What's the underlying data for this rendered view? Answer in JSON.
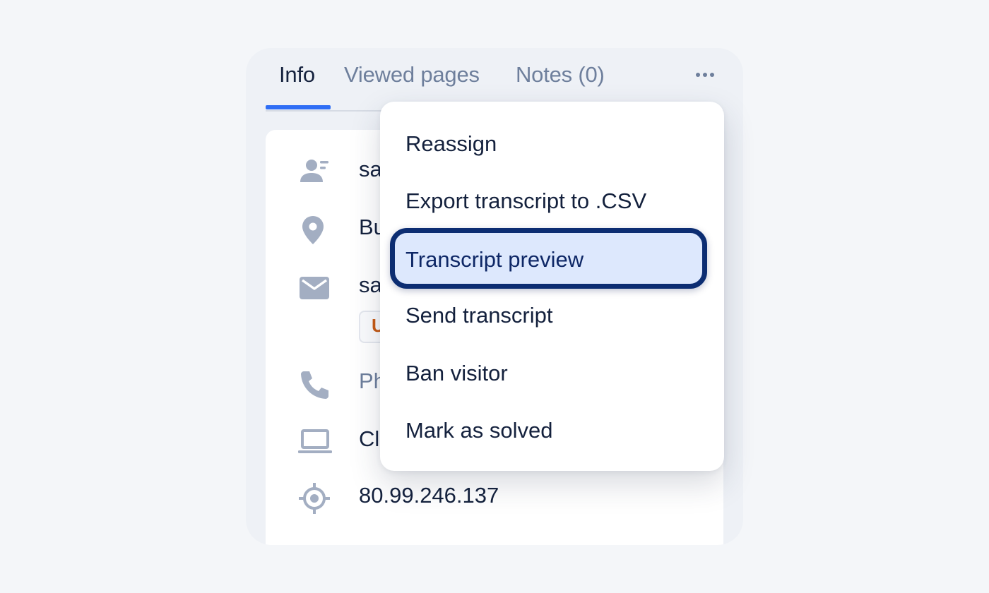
{
  "tabs": [
    {
      "label": "Info",
      "active": true
    },
    {
      "label": "Viewed pages",
      "active": false
    },
    {
      "label": "Notes (0)",
      "active": false
    }
  ],
  "more_icon": "more-horizontal-icon",
  "details": {
    "name_partial": "sa",
    "location_partial": "Bu",
    "email_partial": "sa",
    "email_tag_partial": "U",
    "phone_partial": "Ph",
    "browser_partial": "Cl",
    "ip": "80.99.246.137"
  },
  "icons": {
    "name": "contact-card-icon",
    "location": "map-pin-icon",
    "email": "envelope-icon",
    "phone": "phone-icon",
    "device": "laptop-icon",
    "ip": "target-icon",
    "tag": "tag-icon"
  },
  "menu": {
    "items": [
      {
        "label": "Reassign"
      },
      {
        "label": "Export transcript to .CSV"
      },
      {
        "label": "Transcript preview",
        "highlighted": true
      },
      {
        "label": "Send transcript"
      },
      {
        "label": "Ban visitor"
      },
      {
        "label": "Mark as solved"
      }
    ]
  },
  "colors": {
    "accent": "#2f6ef5",
    "highlight_border": "#0c2d72",
    "highlight_fill": "#dde8fd",
    "icon_gray": "#a3aec2"
  }
}
